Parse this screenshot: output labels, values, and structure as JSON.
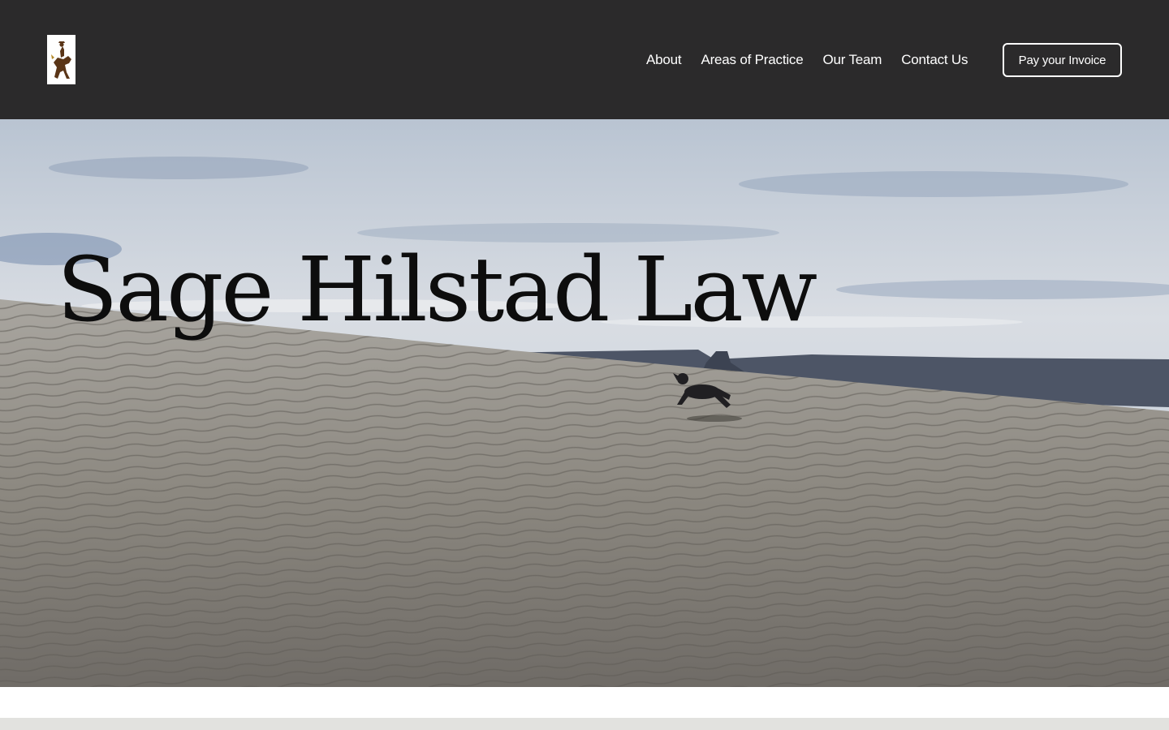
{
  "header": {
    "logo_icon": "bucking-horse-rider-icon",
    "nav": [
      {
        "label": "About"
      },
      {
        "label": "Areas of Practice"
      },
      {
        "label": "Our Team"
      },
      {
        "label": "Contact Us"
      }
    ],
    "cta_label": "Pay your Invoice"
  },
  "hero": {
    "title": "Sage Hilstad Law",
    "image_icon": "desert-dune-dog-photo"
  },
  "colors": {
    "header_bg": "#2b2a2b",
    "nav_text": "#ffffff",
    "footer_strip": "#e2e2df"
  }
}
